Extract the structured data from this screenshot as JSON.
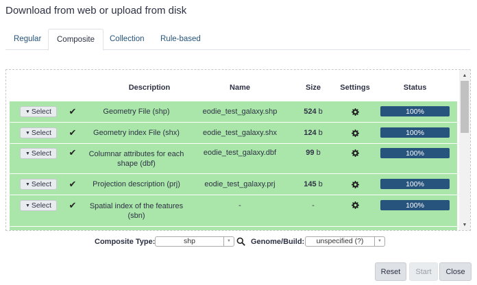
{
  "dialog": {
    "title": "Download from web or upload from disk"
  },
  "tabs": [
    {
      "label": "Regular",
      "active": false
    },
    {
      "label": "Composite",
      "active": true
    },
    {
      "label": "Collection",
      "active": false
    },
    {
      "label": "Rule-based",
      "active": false
    }
  ],
  "table": {
    "headers": {
      "description": "Description",
      "name": "Name",
      "size": "Size",
      "settings": "Settings",
      "status": "Status"
    },
    "rows": [
      {
        "select": "Select",
        "description": "Geometry File (shp)",
        "name": "eodie_test_galaxy.shp",
        "size_num": "524",
        "size_unit": "b",
        "status": "100%",
        "progress": 100
      },
      {
        "select": "Select",
        "description": "Geometry index File (shx)",
        "name": "eodie_test_galaxy.shx",
        "size_num": "124",
        "size_unit": "b",
        "status": "100%",
        "progress": 100
      },
      {
        "select": "Select",
        "description": "Columnar attributes for each shape (dbf)",
        "name": "eodie_test_galaxy.dbf",
        "size_num": "99",
        "size_unit": "b",
        "status": "100%",
        "progress": 100
      },
      {
        "select": "Select",
        "description": "Projection description (prj)",
        "name": "eodie_test_galaxy.prj",
        "size_num": "145",
        "size_unit": "b",
        "status": "100%",
        "progress": 100
      },
      {
        "select": "Select",
        "description": "Spatial index of the features (sbn)",
        "name": "-",
        "size_num": "-",
        "size_unit": "",
        "status": "100%",
        "progress": 100
      }
    ]
  },
  "footer": {
    "composite_type_label": "Composite Type:",
    "composite_type_value": "shp",
    "genome_label": "Genome/Build:",
    "genome_value": "unspecified (?)"
  },
  "buttons": {
    "reset": "Reset",
    "start": "Start",
    "close": "Close"
  },
  "icons": {
    "row_check": "check-icon",
    "settings": "gear-icon",
    "search": "search-icon",
    "select_caret": "caret-down-icon"
  },
  "colors": {
    "row_success": "#aae6aa",
    "progress": "#27547d",
    "link": "#25537b"
  }
}
